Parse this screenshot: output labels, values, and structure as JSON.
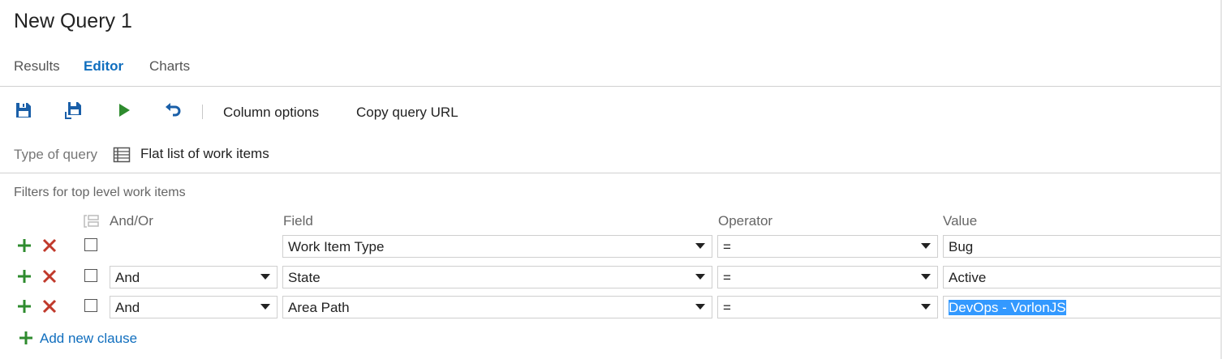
{
  "header": {
    "title": "New Query 1"
  },
  "tabs": [
    {
      "label": "Results",
      "active": false
    },
    {
      "label": "Editor",
      "active": true
    },
    {
      "label": "Charts",
      "active": false
    }
  ],
  "toolbar": {
    "icons": [
      "save-icon",
      "save-as-icon",
      "run-icon",
      "undo-icon"
    ],
    "column_options": "Column options",
    "copy_url": "Copy query URL"
  },
  "query_type": {
    "label": "Type of query",
    "value": "Flat list of work items",
    "icon": "flat-list-icon"
  },
  "filters": {
    "label": "Filters for top level work items",
    "columns": {
      "andor": "And/Or",
      "field": "Field",
      "operator": "Operator",
      "value": "Value"
    },
    "rows": [
      {
        "andor": "",
        "field": "Work Item Type",
        "operator": "=",
        "value": "Bug",
        "selected": false
      },
      {
        "andor": "And",
        "field": "State",
        "operator": "=",
        "value": "Active",
        "selected": false
      },
      {
        "andor": "And",
        "field": "Area Path",
        "operator": "=",
        "value": "DevOps - VorlonJS",
        "selected": true
      }
    ],
    "add_clause": "Add new clause"
  },
  "colors": {
    "accent": "#106ebe",
    "add": "#2e8b2e",
    "delete": "#c0392b",
    "selection": "#3399ff"
  }
}
